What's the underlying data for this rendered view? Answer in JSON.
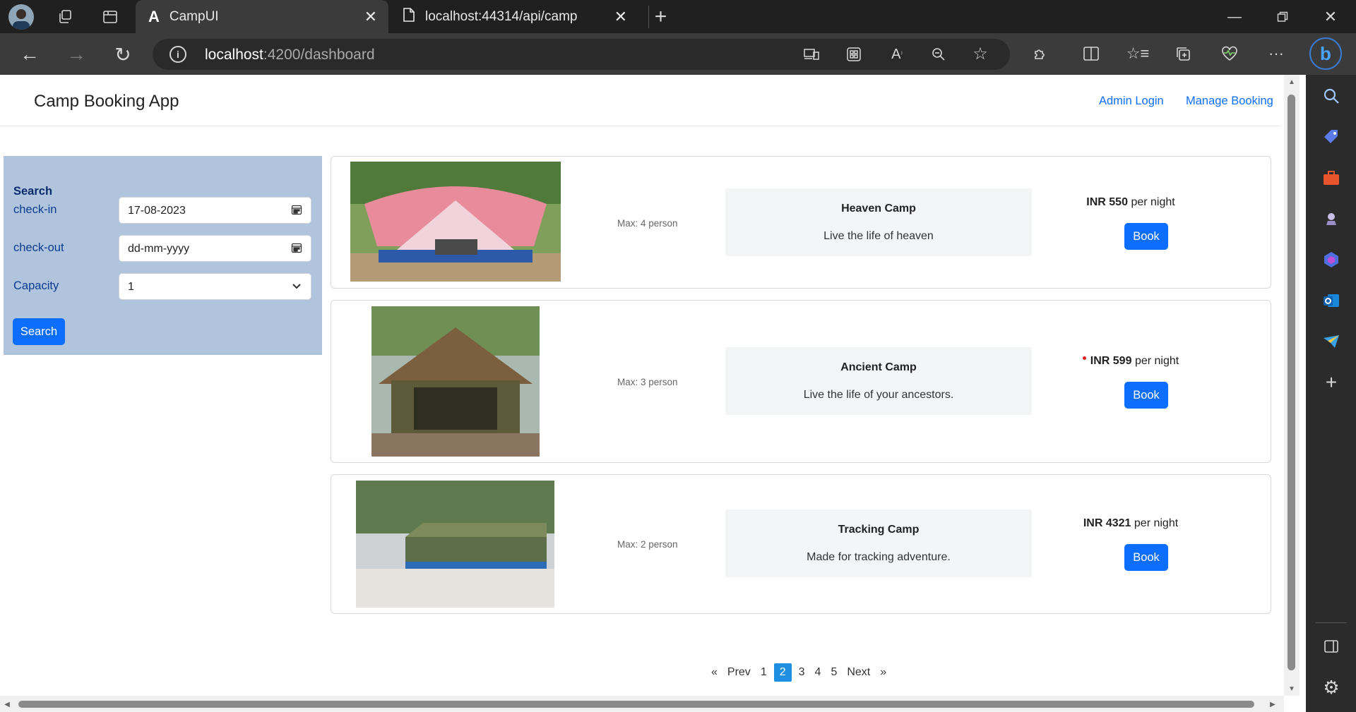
{
  "browser": {
    "tabs": [
      {
        "label": "CampUI",
        "active": true
      },
      {
        "label": "localhost:44314/api/camp",
        "active": false
      }
    ],
    "url_host": "localhost",
    "url_rest": ":4200/dashboard"
  },
  "app": {
    "brand": "Camp Booking App",
    "nav": {
      "admin_login": "Admin Login",
      "manage_booking": "Manage Booking"
    }
  },
  "search": {
    "heading": "Search",
    "checkin_label": "check-in",
    "checkin_value": "17-08-2023",
    "checkout_label": "check-out",
    "checkout_placeholder": "dd-mm-yyyy",
    "capacity_label": "Capacity",
    "capacity_value": "1",
    "button": "Search"
  },
  "camps": [
    {
      "max": "Max: 4 person",
      "name": "Heaven Camp",
      "description": "Live the life of heaven",
      "price": "INR 550",
      "per": "per night",
      "button": "Book"
    },
    {
      "max": "Max: 3 person",
      "name": "Ancient Camp",
      "description": "Live the life of your ancestors.",
      "price": "INR 599",
      "per": "per night",
      "button": "Book"
    },
    {
      "max": "Max: 2 person",
      "name": "Tracking Camp",
      "description": "Made for tracking adventure.",
      "price": "INR 4321",
      "per": "per night",
      "button": "Book"
    }
  ],
  "pagination": {
    "prev": "Prev",
    "next": "Next",
    "pages": [
      "1",
      "2",
      "3",
      "4",
      "5"
    ],
    "current": "2",
    "prev_arrow": "«",
    "next_arrow": "»"
  },
  "colors": {
    "accent": "#0d6efd",
    "panel": "#b1c4de",
    "chrome": "#202020"
  }
}
